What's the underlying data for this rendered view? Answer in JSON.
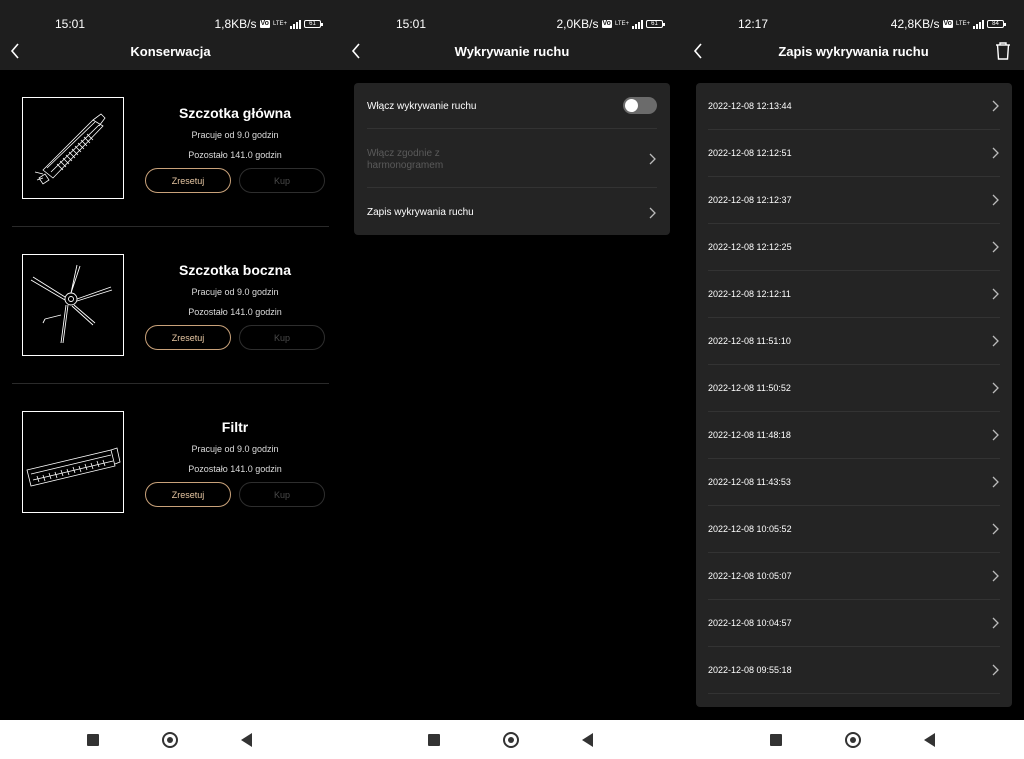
{
  "panels": [
    {
      "status": {
        "time": "15:01",
        "speed": "1,8KB/s",
        "network": "LTE+",
        "battery": "61"
      },
      "title": "Konserwacja",
      "items": [
        {
          "name": "Szczotka główna",
          "worked": "Pracuje od 9.0 godzin",
          "remaining": "Pozostało 141.0 godzin",
          "reset_label": "Zresetuj",
          "buy_label": "Kup",
          "icon": "main-brush-icon"
        },
        {
          "name": "Szczotka boczna",
          "worked": "Pracuje od 9.0 godzin",
          "remaining": "Pozostało 141.0 godzin",
          "reset_label": "Zresetuj",
          "buy_label": "Kup",
          "icon": "side-brush-icon"
        },
        {
          "name": "Filtr",
          "worked": "Pracuje od 9.0 godzin",
          "remaining": "Pozostało 141.0 godzin",
          "reset_label": "Zresetuj",
          "buy_label": "Kup",
          "icon": "filter-icon"
        }
      ]
    },
    {
      "status": {
        "time": "15:01",
        "speed": "2,0KB/s",
        "network": "LTE+",
        "battery": "61"
      },
      "title": "Wykrywanie ruchu",
      "settings": [
        {
          "label": "Włącz wykrywanie ruchu",
          "type": "toggle",
          "state": "off"
        },
        {
          "label": "Włącz zgodnie z harmonogramem",
          "type": "chevron",
          "disabled": true
        },
        {
          "label": "Zapis wykrywania ruchu",
          "type": "chevron"
        }
      ]
    },
    {
      "status": {
        "time": "12:17",
        "speed": "42,8KB/s",
        "network": "LTE+",
        "battery": "84"
      },
      "title": "Zapis wykrywania ruchu",
      "entries": [
        "2022-12-08 12:13:44",
        "2022-12-08 12:12:51",
        "2022-12-08 12:12:37",
        "2022-12-08 12:12:25",
        "2022-12-08 12:12:11",
        "2022-12-08 11:51:10",
        "2022-12-08 11:50:52",
        "2022-12-08 11:48:18",
        "2022-12-08 11:43:53",
        "2022-12-08 10:05:52",
        "2022-12-08 10:05:07",
        "2022-12-08 10:04:57",
        "2022-12-08 09:55:18"
      ]
    }
  ],
  "colors": {
    "accent_button": "#c9a27a",
    "card": "#242424",
    "bar": "#1e1e1e"
  }
}
